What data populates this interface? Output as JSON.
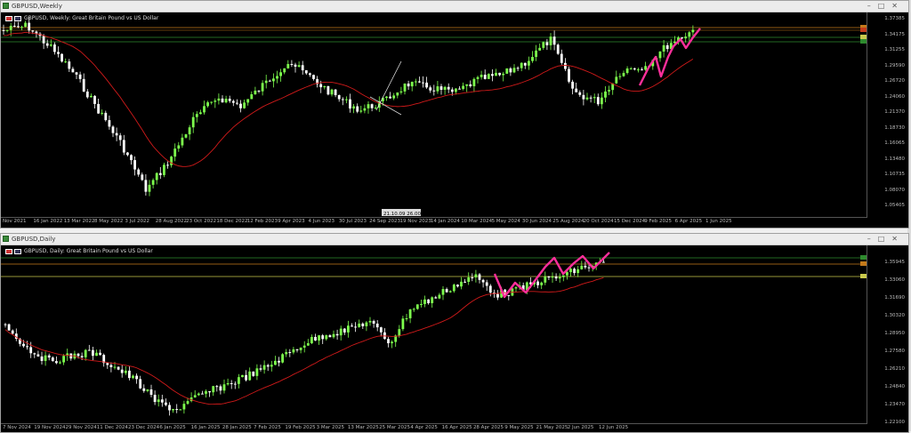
{
  "weekly": {
    "window_title": "GBPUSD,Weekly",
    "symbol_label": "GBPUSD, Weekly:  Great Britain Pound vs US Dollar",
    "price_labels": [
      "1.37385",
      "1.34175",
      "1.31255",
      "1.29590",
      "1.26720",
      "1.24060",
      "1.21370",
      "1.18730",
      "1.16065",
      "1.13480",
      "1.10735",
      "1.08070",
      "1.05405"
    ],
    "date_labels": [
      "Nov 2021",
      "16 Jan 2022",
      "13 Mar 2022",
      "8 May 2022",
      "3 Jul 2022",
      "28 Aug 2022",
      "23 Oct 2022",
      "18 Dec 2022",
      "12 Feb 2023",
      "9 Apr 2023",
      "4 Jun 2023",
      "30 Jul 2023",
      "24 Sep 2023",
      "19 Nov 2023",
      "14 Jan 2024",
      "10 Mar 2024",
      "5 May 2024",
      "30 Jun 2024",
      "25 Aug 2024",
      "20 Oct 2024",
      "15 Dec 2024",
      "9 Feb 2025",
      "6 Apr 2025",
      "1 Jun 2025"
    ],
    "crosshair_label": "21.10.09 26.00"
  },
  "daily": {
    "window_title": "GBPUSD,Daily",
    "symbol_label": "GBPUSD, Daily:  Great Britain Pound vs US Dollar",
    "price_labels": [
      "1.35945",
      "1.33060",
      "1.31690",
      "1.30320",
      "1.28950",
      "1.27580",
      "1.26210",
      "1.24840",
      "1.23470",
      "1.22100"
    ],
    "date_labels": [
      "7 Nov 2024",
      "19 Nov 2024",
      "29 Nov 2024",
      "11 Dec 2024",
      "23 Dec 2024",
      "6 Jan 2025",
      "16 Jan 2025",
      "28 Jan 2025",
      "7 Feb 2025",
      "19 Feb 2025",
      "3 Mar 2025",
      "13 Mar 2025",
      "25 Mar 2025",
      "4 Apr 2025",
      "16 Apr 2025",
      "28 Apr 2025",
      "9 May 2025",
      "21 May 2025",
      "2 Jun 2025",
      "12 Jun 2025"
    ]
  },
  "colors": {
    "bull": "#7dff4d",
    "bear": "#ffffff",
    "ma": "#d11a1a",
    "pattern": "#ff2f9b",
    "hline_green": "#2e8b2e",
    "hline_orange": "#c47a1b",
    "hline_yellow": "#c9c94d"
  }
}
